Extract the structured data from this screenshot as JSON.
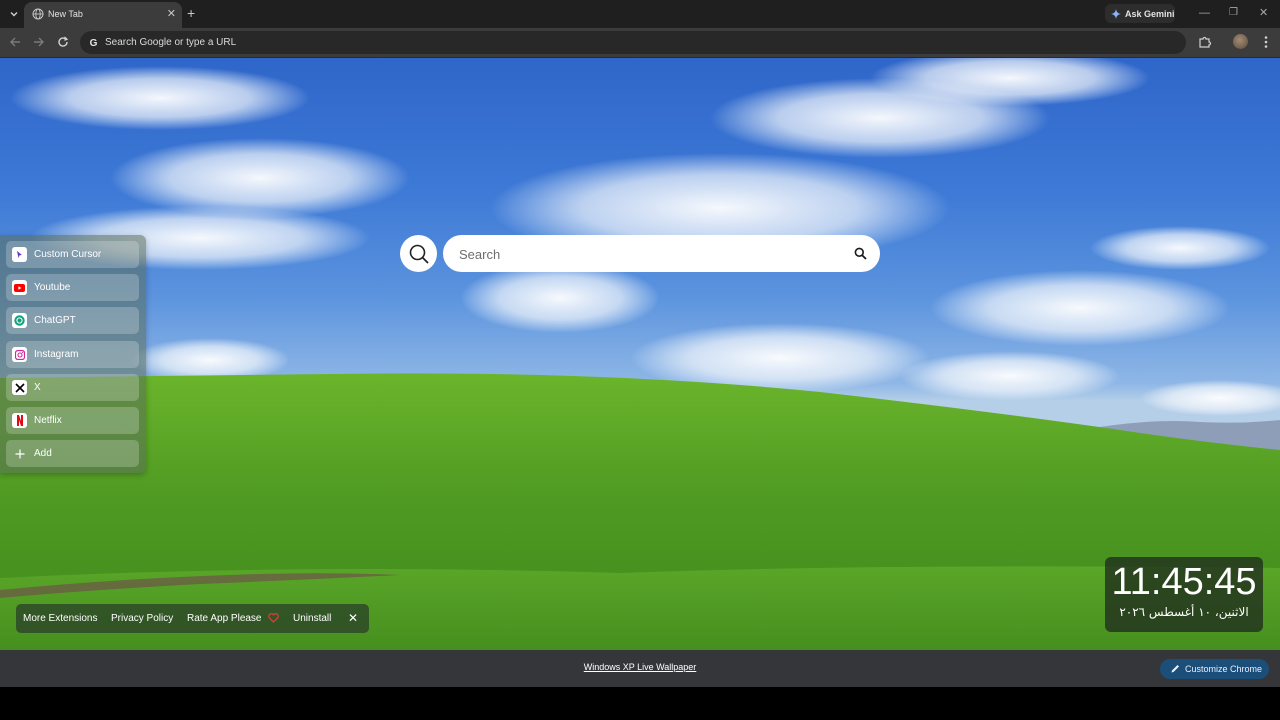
{
  "browser": {
    "tab_title": "New Tab",
    "ask_gemini_label": "Ask Gemini",
    "omnibox_placeholder": "Search Google or type a URL"
  },
  "sidebar": {
    "items": [
      {
        "label": "Custom Cursor",
        "icon": "cursor-icon"
      },
      {
        "label": "Youtube",
        "icon": "youtube-icon"
      },
      {
        "label": "ChatGPT",
        "icon": "chatgpt-icon"
      },
      {
        "label": "Instagram",
        "icon": "instagram-icon"
      },
      {
        "label": "X",
        "icon": "x-icon"
      },
      {
        "label": "Netflix",
        "icon": "netflix-icon"
      },
      {
        "label": "Add",
        "icon": "plus-icon"
      }
    ]
  },
  "search": {
    "placeholder": "Search"
  },
  "footer": {
    "more_extensions": "More Extensions",
    "privacy_policy": "Privacy Policy",
    "rate_app": "Rate App Please",
    "uninstall": "Uninstall"
  },
  "clock": {
    "time": "11:45:45",
    "date": "الاثنين، ١٠ أغسطس ٢٠٢٦"
  },
  "bottom_bar": {
    "wallpaper_link": "Windows XP Live Wallpaper",
    "customize_label": "Customize Chrome"
  },
  "colors": {
    "sky": "#3d79d6",
    "grass": "#5fa82e",
    "customize_button": "#1b4f7a"
  }
}
